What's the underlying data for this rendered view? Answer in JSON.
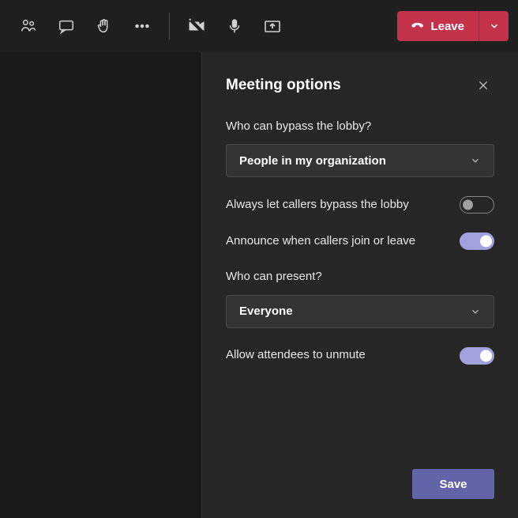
{
  "toolbar": {
    "leave_label": "Leave"
  },
  "panel": {
    "title": "Meeting options",
    "bypass": {
      "label": "Who can bypass the lobby?",
      "value": "People in my organization"
    },
    "callers_bypass": {
      "label": "Always let callers bypass the lobby",
      "on": false
    },
    "announce": {
      "label": "Announce when callers join or leave",
      "on": true
    },
    "present": {
      "label": "Who can present?",
      "value": "Everyone"
    },
    "unmute": {
      "label": "Allow attendees to unmute",
      "on": true
    },
    "save_label": "Save"
  }
}
